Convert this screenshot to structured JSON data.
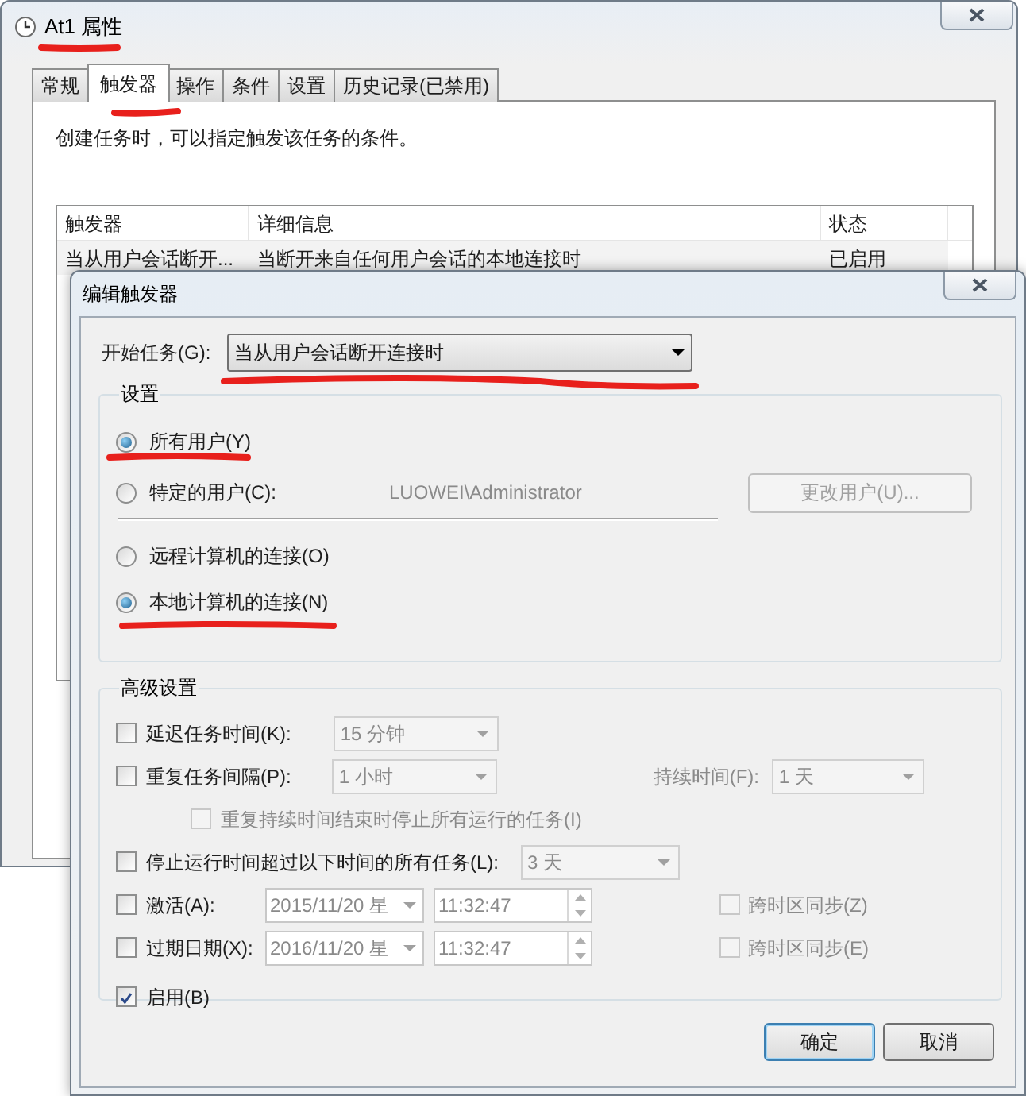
{
  "properties_window": {
    "title": "At1 属性",
    "tabs": [
      {
        "label": "常规",
        "selected": false
      },
      {
        "label": "触发器",
        "selected": true
      },
      {
        "label": "操作",
        "selected": false
      },
      {
        "label": "条件",
        "selected": false
      },
      {
        "label": "设置",
        "selected": false
      },
      {
        "label": "历史记录(已禁用)",
        "selected": false
      }
    ],
    "description": "创建任务时，可以指定触发该任务的条件。",
    "table": {
      "columns": [
        "触发器",
        "详细信息",
        "状态"
      ],
      "rows": [
        [
          "当从用户会话断开...",
          "当断开来自任何用户会话的本地连接时",
          "已启用"
        ]
      ]
    }
  },
  "edit_trigger_dialog": {
    "title": "编辑触发器",
    "begin_task": {
      "label": "开始任务(G):",
      "value": "当从用户会话断开连接时"
    },
    "settings": {
      "title": "设置",
      "user_options": [
        {
          "label": "所有用户(Y)",
          "selected": true
        },
        {
          "label": "特定的用户(C):",
          "selected": false
        }
      ],
      "user_name": "LUOWEI\\Administrator",
      "change_user_button": {
        "label": "更改用户(U)...",
        "disabled": true
      },
      "connection_options": [
        {
          "label": "远程计算机的连接(O)",
          "selected": false
        },
        {
          "label": "本地计算机的连接(N)",
          "selected": true
        }
      ]
    },
    "advanced": {
      "title": "高级设置",
      "delay": {
        "label": "延迟任务时间(K):",
        "checked": false,
        "value": "15 分钟"
      },
      "repeat": {
        "label": "重复任务间隔(P):",
        "checked": false,
        "value": "1 小时",
        "duration_label": "持续时间(F):",
        "duration_value": "1 天"
      },
      "stop_at_duration_end": {
        "label": "重复持续时间结束时停止所有运行的任务(I)",
        "checked": false
      },
      "stop_if_longer": {
        "label": "停止运行时间超过以下时间的所有任务(L):",
        "checked": false,
        "value": "3 天"
      },
      "activate": {
        "label": "激活(A):",
        "checked": false,
        "date": "2015/11/20 星",
        "time": "11:32:47",
        "sync_label": "跨时区同步(Z)",
        "sync_checked": false
      },
      "expire": {
        "label": "过期日期(X):",
        "checked": false,
        "date": "2016/11/20 星",
        "time": "11:32:47",
        "sync_label": "跨时区同步(E)",
        "sync_checked": false
      },
      "enabled": {
        "label": "启用(B)",
        "checked": true
      }
    },
    "buttons": [
      {
        "label": "确定",
        "default": true
      },
      {
        "label": "取消",
        "default": false
      }
    ]
  }
}
